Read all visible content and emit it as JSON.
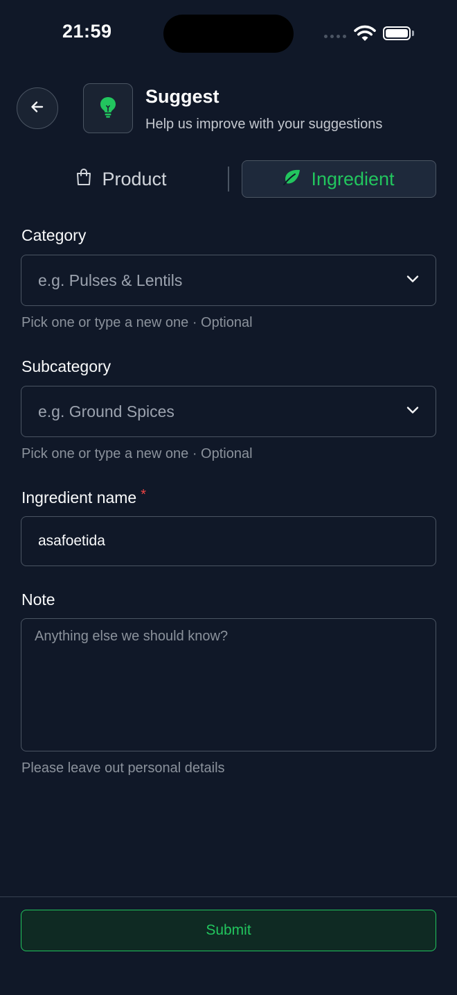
{
  "status_bar": {
    "time": "21:59"
  },
  "header": {
    "title": "Suggest",
    "subtitle": "Help us improve with your suggestions",
    "back_icon": "arrow-left-icon",
    "logo_icon": "lightbulb-icon"
  },
  "tabs": [
    {
      "label": "Product",
      "icon": "shopping-bag-icon",
      "selected": false
    },
    {
      "label": "Ingredient",
      "icon": "leaf-icon",
      "selected": true
    }
  ],
  "form": {
    "category": {
      "label": "Category",
      "placeholder": "e.g. Pulses & Lentils",
      "helper": "Pick one or type a new one · Optional"
    },
    "subcategory": {
      "label": "Subcategory",
      "placeholder": "e.g. Ground Spices",
      "helper": "Pick one or type a new one · Optional"
    },
    "ingredient_name": {
      "label": "Ingredient name",
      "required_mark": "*",
      "value": "asafoetida"
    },
    "note": {
      "label": "Note",
      "placeholder": "Anything else we should know?",
      "helper": "Please leave out personal details"
    }
  },
  "footer": {
    "submit_label": "Submit"
  },
  "colors": {
    "background": "#101828",
    "accent": "#22c55e",
    "border": "#4b5563",
    "required": "#ef4444"
  }
}
